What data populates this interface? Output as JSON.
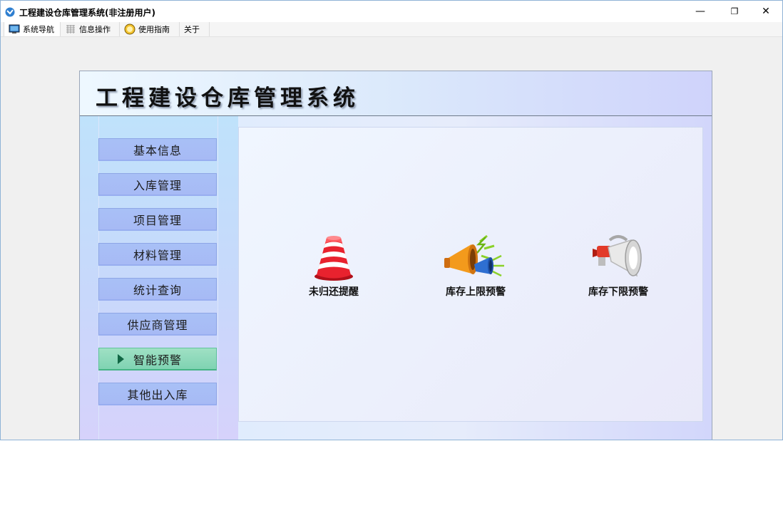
{
  "window": {
    "title": "工程建设仓库管理系统(非注册用户)",
    "controls": {
      "minimize": "—",
      "restore": "❐",
      "close": "✕"
    }
  },
  "menubar": {
    "items": [
      {
        "label": "系统导航",
        "icon": "monitor-icon"
      },
      {
        "label": "信息操作",
        "icon": "grid-icon"
      },
      {
        "label": "使用指南",
        "icon": "help-disc-icon"
      },
      {
        "label": "关于",
        "icon": ""
      }
    ],
    "active_index": 0
  },
  "header": {
    "title": "工程建设仓库管理系统"
  },
  "sidebar": {
    "items": [
      {
        "label": "基本信息"
      },
      {
        "label": "入库管理"
      },
      {
        "label": "项目管理"
      },
      {
        "label": "材料管理"
      },
      {
        "label": "统计查询"
      },
      {
        "label": "供应商管理"
      },
      {
        "label": "智能预警"
      },
      {
        "label": "其他出入库"
      }
    ],
    "active_index": 6
  },
  "content": {
    "tiles": [
      {
        "label": "未归还提醒",
        "icon": "traffic-cone-icon"
      },
      {
        "label": "库存上限预警",
        "icon": "megaphone-icon"
      },
      {
        "label": "库存下限预警",
        "icon": "loudspeaker-icon"
      }
    ]
  },
  "colors": {
    "nav_button": "#a8c0f6",
    "nav_active": "#7fd3b2",
    "header_bg": "#dbe9fb",
    "window_border": "#8fb3d6"
  }
}
